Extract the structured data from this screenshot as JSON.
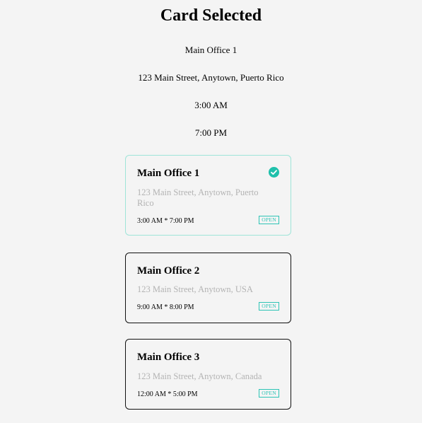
{
  "header": {
    "title": "Card Selected"
  },
  "summary": {
    "name": "Main Office 1",
    "address": "123 Main Street, Anytown, Puerto Rico",
    "open_time": "3:00 AM",
    "close_time": "7:00 PM"
  },
  "cards": [
    {
      "name": "Main Office 1",
      "address": "123 Main Street, Anytown, Puerto Rico",
      "hours": "3:00 AM * 7:00 PM",
      "status": "OPEN",
      "selected": true
    },
    {
      "name": "Main Office 2",
      "address": "123 Main Street, Anytown, USA",
      "hours": "9:00 AM * 8:00 PM",
      "status": "OPEN",
      "selected": false
    },
    {
      "name": "Main Office 3",
      "address": "123 Main Street, Anytown, Canada",
      "hours": "12:00 AM * 5:00 PM",
      "status": "OPEN",
      "selected": false
    }
  ],
  "colors": {
    "accent": "#1fc0ab",
    "selected_border": "#9ee4d8",
    "muted_text": "#b3b3b3",
    "background": "#f4f4f4"
  },
  "icons": {
    "selected_indicator": "check-circle-icon"
  }
}
